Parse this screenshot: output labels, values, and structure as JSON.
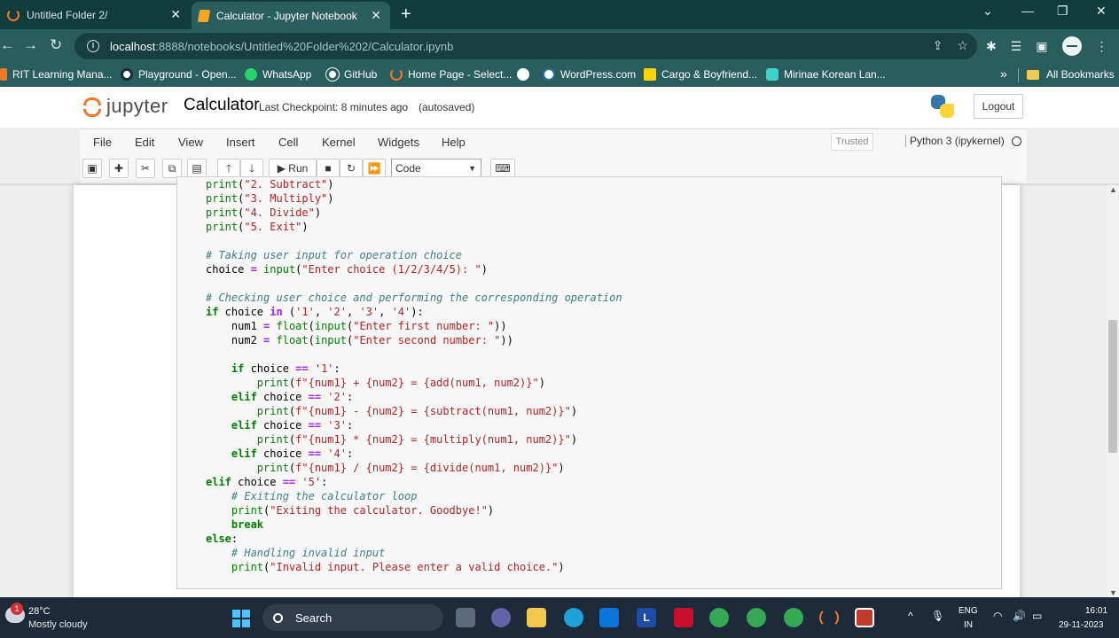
{
  "browser": {
    "tabs": [
      {
        "title": "Untitled Folder 2/",
        "active": false
      },
      {
        "title": "Calculator - Jupyter Notebook",
        "active": true
      }
    ],
    "new_tab": "+",
    "url_host": "localhost",
    "url_rest": ":8888/notebooks/Untitled%20Folder%202/Calculator.ipynb",
    "bookmarks": [
      "RIT Learning Mana...",
      "Playground - Open...",
      "WhatsApp",
      "GitHub",
      "Home Page - Select...",
      "WordPress.com",
      "Cargo & Boyfriend...",
      "Mirinae Korean Lan..."
    ],
    "all_bookmarks": "All Bookmarks"
  },
  "jupyter": {
    "logo_text": "jupyter",
    "notebook_name": "Calculator",
    "checkpoint": "Last Checkpoint: 8 minutes ago",
    "autosaved": "(autosaved)",
    "logout": "Logout",
    "menu": [
      "File",
      "Edit",
      "View",
      "Insert",
      "Cell",
      "Kernel",
      "Widgets",
      "Help"
    ],
    "trusted": "Trusted",
    "kernel": "Python 3 (ipykernel)",
    "run_label": "Run",
    "cell_type": "Code"
  },
  "taskbar": {
    "temperature": "28°C",
    "condition": "Mostly cloudy",
    "weather_badge": "1",
    "search": "Search",
    "lang1": "ENG",
    "lang2": "IN",
    "time": "16:01",
    "date": "29-11-2023"
  }
}
